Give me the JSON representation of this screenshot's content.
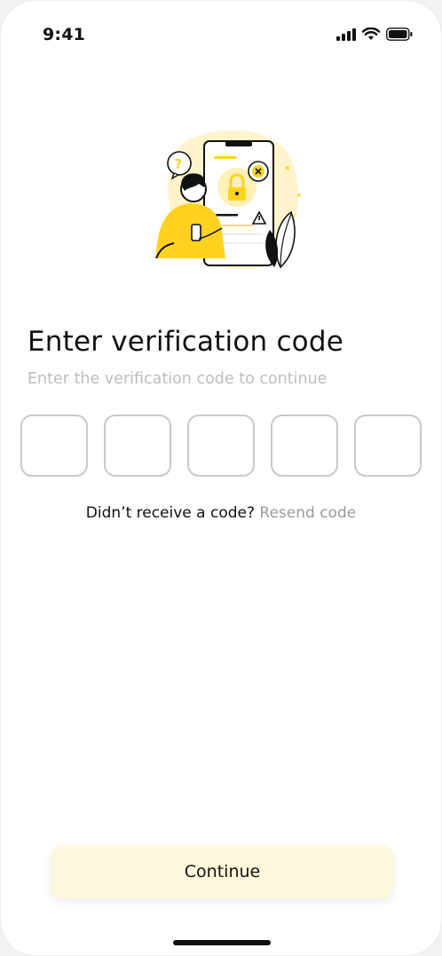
{
  "status_bar": {
    "time": "9:41",
    "icons": [
      "cellular-signal-icon",
      "wifi-icon",
      "battery-icon"
    ]
  },
  "illustration": {
    "description_icon": "security-lock-illustration",
    "accent_color": "#ffd21f"
  },
  "title": "Enter verification code",
  "subtitle": "Enter the verification code to continue",
  "code_inputs": [
    "",
    "",
    "",
    "",
    ""
  ],
  "resend": {
    "prompt": "Didn’t receive a code?",
    "link": "Resend code"
  },
  "continue_label": "Continue",
  "colors": {
    "button_bg": "#fff7dc",
    "input_border": "#c9c9c9",
    "muted_text": "#bdbdbd"
  }
}
